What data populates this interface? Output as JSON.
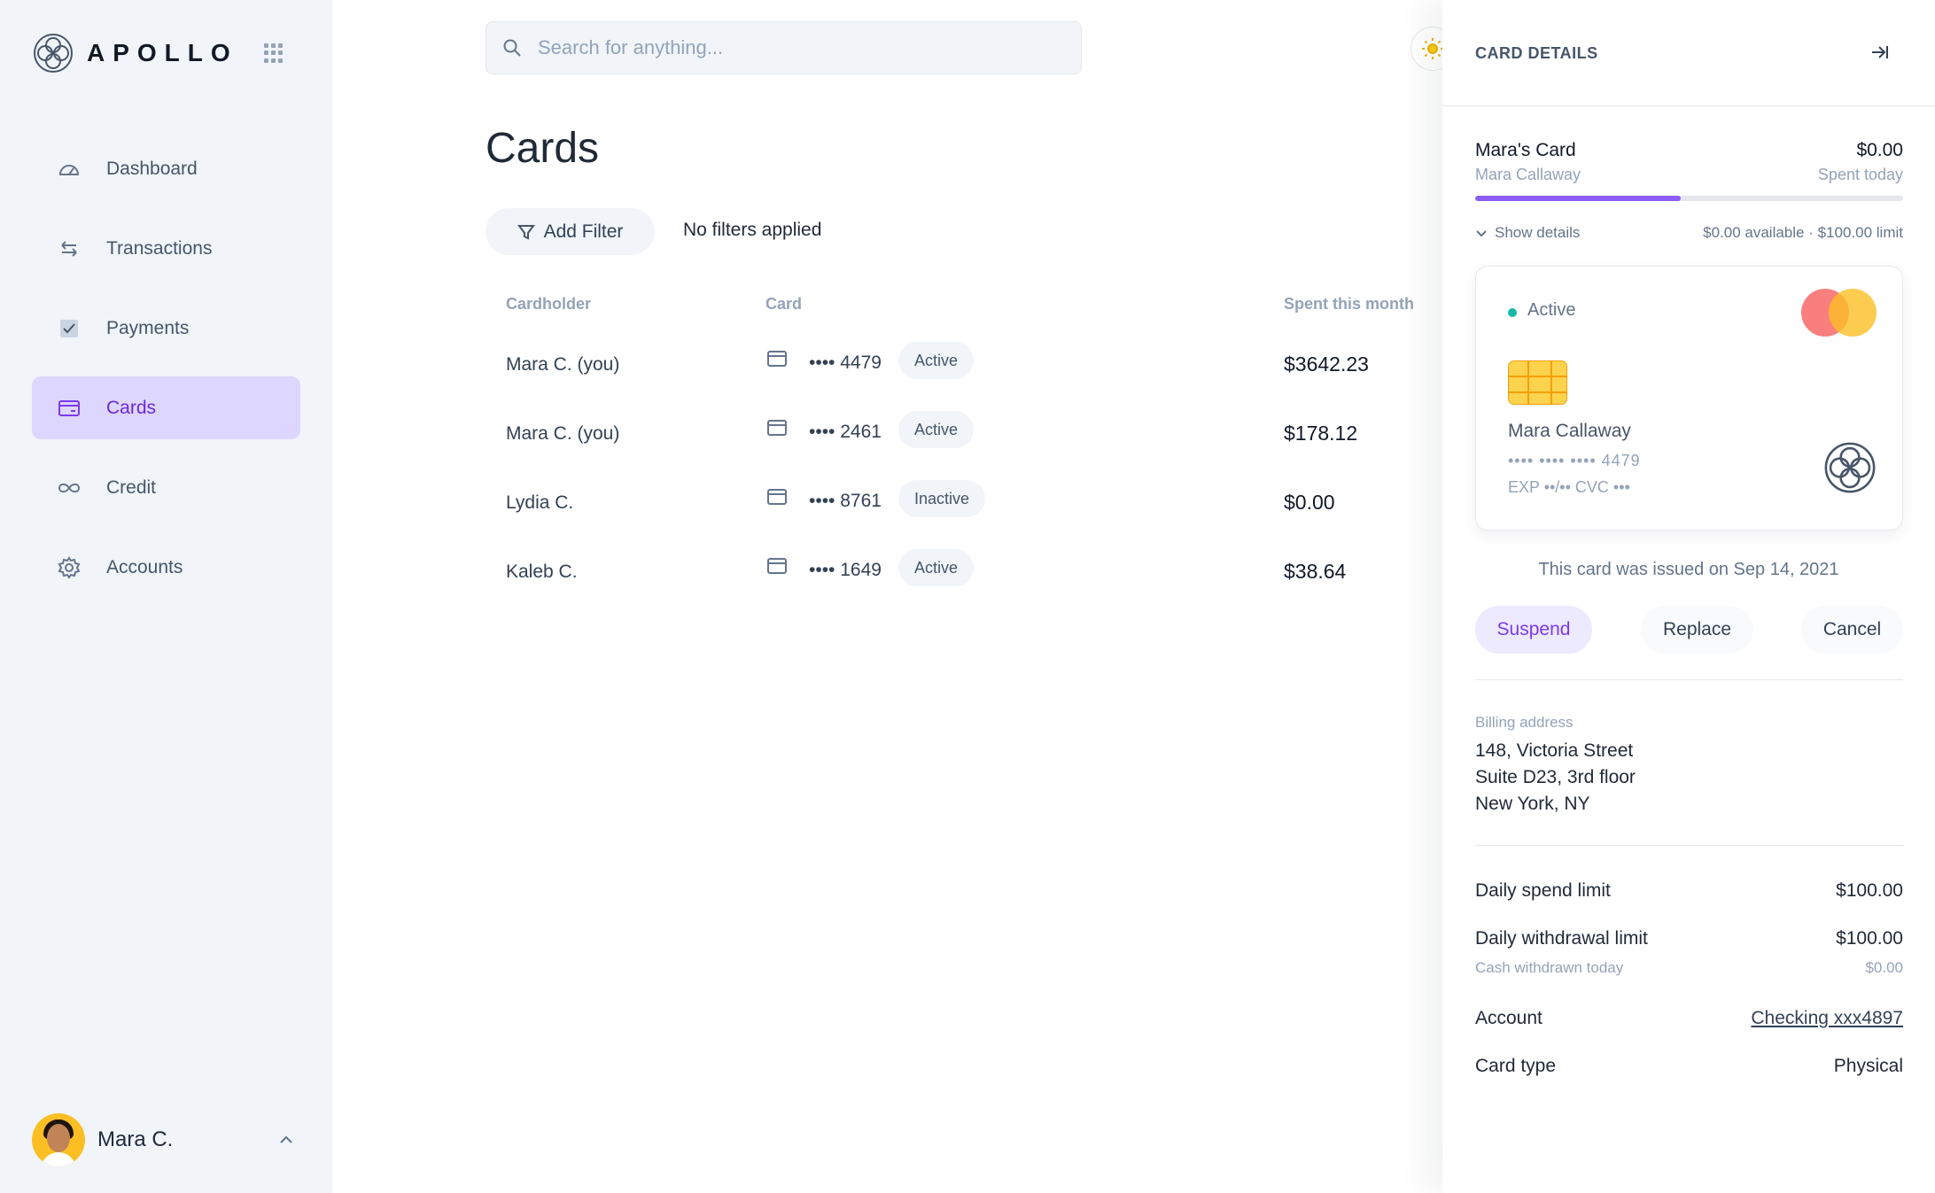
{
  "app": {
    "name": "APOLLO"
  },
  "sidebar": {
    "items": [
      {
        "label": "Dashboard",
        "icon": "gauge-icon"
      },
      {
        "label": "Transactions",
        "icon": "arrows-swap-icon"
      },
      {
        "label": "Payments",
        "icon": "checkbox-icon"
      },
      {
        "label": "Cards",
        "icon": "credit-card-icon",
        "active": true
      },
      {
        "label": "Credit",
        "icon": "infinity-icon"
      },
      {
        "label": "Accounts",
        "icon": "gear-icon"
      }
    ],
    "user": {
      "name": "Mara C."
    }
  },
  "search": {
    "placeholder": "Search for anything..."
  },
  "main": {
    "title": "Cards",
    "filter_button": "Add Filter",
    "filter_status": "No filters applied",
    "columns": [
      "Cardholder",
      "Card",
      "Spent this month"
    ],
    "rows": [
      {
        "holder": "Mara C. (you)",
        "card": "•••• 4479",
        "status": "Active",
        "spent": "$3642.23"
      },
      {
        "holder": "Mara C. (you)",
        "card": "•••• 2461",
        "status": "Active",
        "spent": "$178.12"
      },
      {
        "holder": "Lydia C.",
        "card": "•••• 8761",
        "status": "Inactive",
        "spent": "$0.00"
      },
      {
        "holder": "Kaleb C.",
        "card": "•••• 1649",
        "status": "Active",
        "spent": "$38.64"
      }
    ]
  },
  "details": {
    "title": "CARD DETAILS",
    "card_name": "Mara's Card",
    "holder": "Mara Callaway",
    "spent_today": "$0.00",
    "spent_today_label": "Spent today",
    "progress": 0.48,
    "show_details": "Show details",
    "limits_line": "$0.00 available · $100.00 limit",
    "card": {
      "status": "Active",
      "holder": "Mara Callaway",
      "number": "•••• •••• •••• 4479",
      "exp_cvc": "EXP  ••/••  CVC  •••"
    },
    "issued": "This card was issued on Sep 14, 2021",
    "actions": {
      "suspend": "Suspend",
      "replace": "Replace",
      "cancel": "Cancel"
    },
    "billing": {
      "label": "Billing address",
      "line1": "148, Victoria Street",
      "line2": "Suite D23, 3rd floor",
      "line3": "New York, NY"
    },
    "daily_spend_limit": {
      "label": "Daily spend limit",
      "value": "$100.00"
    },
    "daily_withdrawal_limit": {
      "label": "Daily withdrawal limit",
      "value": "$100.00",
      "sub_label": "Cash withdrawn today",
      "sub_value": "$0.00"
    },
    "account": {
      "label": "Account",
      "value": "Checking xxx4897"
    },
    "card_type": {
      "label": "Card type",
      "value": "Physical"
    }
  },
  "colors": {
    "accent": "#7c3aed",
    "accent_bg": "#ddd6fe",
    "active_dot": "#14b8a6"
  }
}
